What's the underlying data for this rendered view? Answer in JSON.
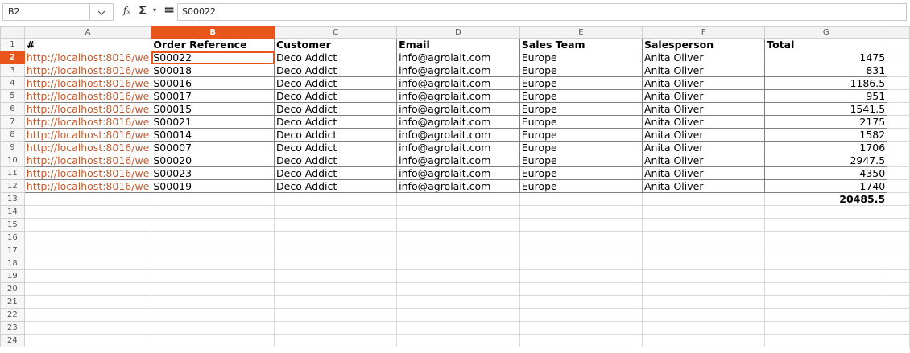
{
  "formula_bar": {
    "cell_ref": "B2",
    "fx_label": "fₓ",
    "sigma_label": "Σ",
    "equals_label": "=",
    "formula_value": "S00022"
  },
  "columns": [
    "A",
    "B",
    "C",
    "D",
    "E",
    "F",
    "G"
  ],
  "active_column": "B",
  "active_row": 2,
  "header_row": [
    "#",
    "Order Reference",
    "Customer",
    "Email",
    "Sales Team",
    "Salesperson",
    "Total"
  ],
  "rows": [
    {
      "link": "http://localhost:8016/we",
      "ref": "S00022",
      "customer": "Deco Addict",
      "email": "info@agrolait.com",
      "team": "Europe",
      "person": "Anita Oliver",
      "total": "1475"
    },
    {
      "link": "http://localhost:8016/we",
      "ref": "S00018",
      "customer": "Deco Addict",
      "email": "info@agrolait.com",
      "team": "Europe",
      "person": "Anita Oliver",
      "total": "831"
    },
    {
      "link": "http://localhost:8016/we",
      "ref": "S00016",
      "customer": "Deco Addict",
      "email": "info@agrolait.com",
      "team": "Europe",
      "person": "Anita Oliver",
      "total": "1186.5"
    },
    {
      "link": "http://localhost:8016/we",
      "ref": "S00017",
      "customer": "Deco Addict",
      "email": "info@agrolait.com",
      "team": "Europe",
      "person": "Anita Oliver",
      "total": "951"
    },
    {
      "link": "http://localhost:8016/we",
      "ref": "S00015",
      "customer": "Deco Addict",
      "email": "info@agrolait.com",
      "team": "Europe",
      "person": "Anita Oliver",
      "total": "1541.5"
    },
    {
      "link": "http://localhost:8016/we",
      "ref": "S00021",
      "customer": "Deco Addict",
      "email": "info@agrolait.com",
      "team": "Europe",
      "person": "Anita Oliver",
      "total": "2175"
    },
    {
      "link": "http://localhost:8016/we",
      "ref": "S00014",
      "customer": "Deco Addict",
      "email": "info@agrolait.com",
      "team": "Europe",
      "person": "Anita Oliver",
      "total": "1582"
    },
    {
      "link": "http://localhost:8016/we",
      "ref": "S00007",
      "customer": "Deco Addict",
      "email": "info@agrolait.com",
      "team": "Europe",
      "person": "Anita Oliver",
      "total": "1706"
    },
    {
      "link": "http://localhost:8016/we",
      "ref": "S00020",
      "customer": "Deco Addict",
      "email": "info@agrolait.com",
      "team": "Europe",
      "person": "Anita Oliver",
      "total": "2947.5"
    },
    {
      "link": "http://localhost:8016/we",
      "ref": "S00023",
      "customer": "Deco Addict",
      "email": "info@agrolait.com",
      "team": "Europe",
      "person": "Anita Oliver",
      "total": "4350"
    },
    {
      "link": "http://localhost:8016/we",
      "ref": "S00019",
      "customer": "Deco Addict",
      "email": "info@agrolait.com",
      "team": "Europe",
      "person": "Anita Oliver",
      "total": "1740"
    }
  ],
  "grand_total": "20485.5",
  "row_numbers": [
    "1",
    "2",
    "3",
    "4",
    "5",
    "6",
    "7",
    "8",
    "9",
    "10",
    "11",
    "12",
    "13",
    "14",
    "15",
    "16",
    "17",
    "18",
    "19",
    "20",
    "21",
    "22",
    "23",
    "24"
  ]
}
